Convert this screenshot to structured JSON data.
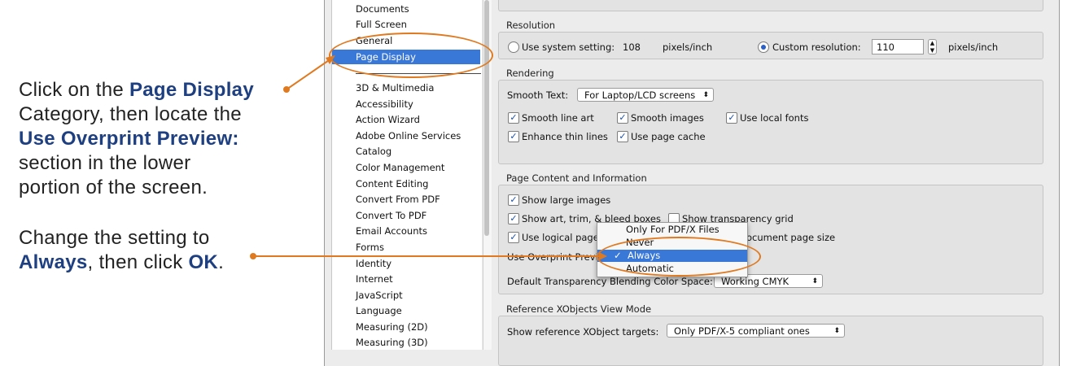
{
  "instructions": {
    "first": {
      "line1_pre": "Click on the ",
      "line1_bold": "Page Display",
      "line2": "Category, then locate the",
      "line3_bold": "Use Overprint Preview:",
      "line4": "section in the lower",
      "line5": "portion of the screen."
    },
    "second": {
      "line1": "Change the setting to",
      "line2_bold1": "Always",
      "line2_mid": ", then click ",
      "line2_bold2": "OK",
      "line2_end": "."
    }
  },
  "categories": {
    "top": [
      "Documents",
      "Full Screen",
      "General",
      "Page Display"
    ],
    "selected": "Page Display",
    "bottom": [
      "3D & Multimedia",
      "Accessibility",
      "Action Wizard",
      "Adobe Online Services",
      "Catalog",
      "Color Management",
      "Content Editing",
      "Convert From PDF",
      "Convert To PDF",
      "Email Accounts",
      "Forms",
      "Identity",
      "Internet",
      "JavaScript",
      "Language",
      "Measuring (2D)",
      "Measuring (3D)"
    ]
  },
  "resolution": {
    "title": "Resolution",
    "system_label": "Use system setting:",
    "system_value": "108",
    "system_unit": "pixels/inch",
    "custom_label": "Custom resolution:",
    "custom_value": "110",
    "custom_unit": "pixels/inch"
  },
  "rendering": {
    "title": "Rendering",
    "smooth_text_label": "Smooth Text:",
    "smooth_text_value": "For Laptop/LCD screens",
    "smooth_line_art": "Smooth line art",
    "smooth_images": "Smooth images",
    "use_local_fonts": "Use local fonts",
    "enhance_thin_lines": "Enhance thin lines",
    "use_page_cache": "Use page cache"
  },
  "page_content": {
    "title": "Page Content and Information",
    "show_large_images": "Show large images",
    "show_art_trim": "Show art, trim, & bleed boxes",
    "show_transparency_grid": "Show transparency grid",
    "use_logical_page": "Use logical page nu",
    "document_page_size": "ocument page size",
    "overprint_label": "Use Overprint Preview:",
    "blending_label": "Default Transparency Blending Color Space:",
    "blending_value": "Working CMYK"
  },
  "overprint_menu": {
    "options": [
      "Only For PDF/X Files",
      "Never",
      "Always",
      "Automatic"
    ],
    "selected": "Always",
    "check": "✓"
  },
  "reference": {
    "title": "Reference XObjects View Mode",
    "targets_label": "Show reference XObject targets:",
    "targets_value": "Only PDF/X-5 compliant ones"
  },
  "colors": {
    "accent": "#e07a20",
    "selection": "#3a78d8",
    "bold_text": "#1e3f80"
  }
}
